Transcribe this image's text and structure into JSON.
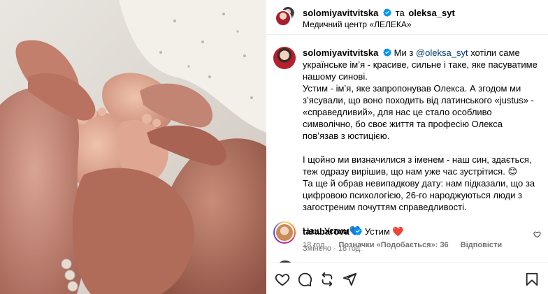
{
  "header": {
    "user1": "solomiyavitvitska",
    "connector": "та",
    "user2": "oleksa_syt",
    "location": "Медичний центр «ЛЕЛЕКА»"
  },
  "caption": {
    "username": "solomiyavitvitska",
    "p1_a": "Ми з",
    "p1_mention": "@oleksa_syt",
    "p1_b": "хотіли саме українське імʼя - красиве, сильне і таке, яке пасуватиме нашому синові.",
    "p2": "Устим - імʼя, яке запропонував Олекса. А згодом ми зʼясували, що воно походить від латинського «justus» - «справедливий», для нас це стало особливо символічно, бо своє життя та професію Олекса повʼязав з юстицією.",
    "p3": "І щойно ми визначилися з іменем - наш син, здається, теж одразу вирішив, що нам уже час зустрітися. 😊",
    "p4": "Та ще й обрав невипадкову дату: нам підказали, що за цифровою психологією, 26-го народжуються люди з загостреним почуттям справедливості.",
    "p5": "Наш Устим💙",
    "edited": "Змінено",
    "time": "18 год."
  },
  "comment": {
    "username": "tarabarova",
    "text": "Устим",
    "emoji": "❤️",
    "time": "18 год.",
    "likes": "Позначки «Подобається»: 36",
    "reply": "Відповісти"
  },
  "icons": {
    "verified": "verified-badge-icon",
    "like": "heart-outline-icon",
    "comment": "comment-bubble-icon",
    "share": "repost-icon",
    "send": "send-plane-icon",
    "save": "bookmark-icon"
  },
  "colors": {
    "verified": "#0095f6",
    "mention": "#00376b",
    "secondary_text": "#737373",
    "heart": "#ed4956"
  }
}
